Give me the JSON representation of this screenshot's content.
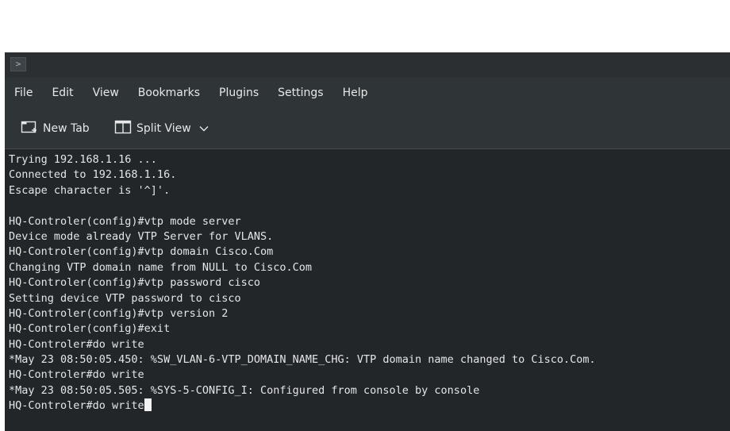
{
  "menubar": {
    "items": [
      "File",
      "Edit",
      "View",
      "Bookmarks",
      "Plugins",
      "Settings",
      "Help"
    ]
  },
  "titlebar": {
    "icon": "terminal-app-icon",
    "glyph": ">"
  },
  "toolbar": {
    "new_tab_label": "New Tab",
    "new_tab_icon": "new-tab-icon",
    "split_view_label": "Split View",
    "split_view_icon": "split-view-icon",
    "split_view_dropdown_icon": "chevron-down-icon"
  },
  "terminal": {
    "lines": [
      "Trying 192.168.1.16 ...",
      "Connected to 192.168.1.16.",
      "Escape character is '^]'.",
      "",
      "HQ-Controler(config)#vtp mode server",
      "Device mode already VTP Server for VLANS.",
      "HQ-Controler(config)#vtp domain Cisco.Com",
      "Changing VTP domain name from NULL to Cisco.Com",
      "HQ-Controler(config)#vtp password cisco",
      "Setting device VTP password to cisco",
      "HQ-Controler(config)#vtp version 2",
      "HQ-Controler(config)#exit",
      "HQ-Controler#do write",
      "*May 23 08:50:05.450: %SW_VLAN-6-VTP_DOMAIN_NAME_CHG: VTP domain name changed to Cisco.Com.",
      "HQ-Controler#do write",
      "*May 23 08:50:05.505: %SYS-5-CONFIG_I: Configured from console by console",
      "HQ-Controler#do write"
    ]
  },
  "colors": {
    "terminal_bg": "#222629",
    "terminal_fg": "#e4e6e8",
    "chrome_bg": "#2f3437"
  }
}
